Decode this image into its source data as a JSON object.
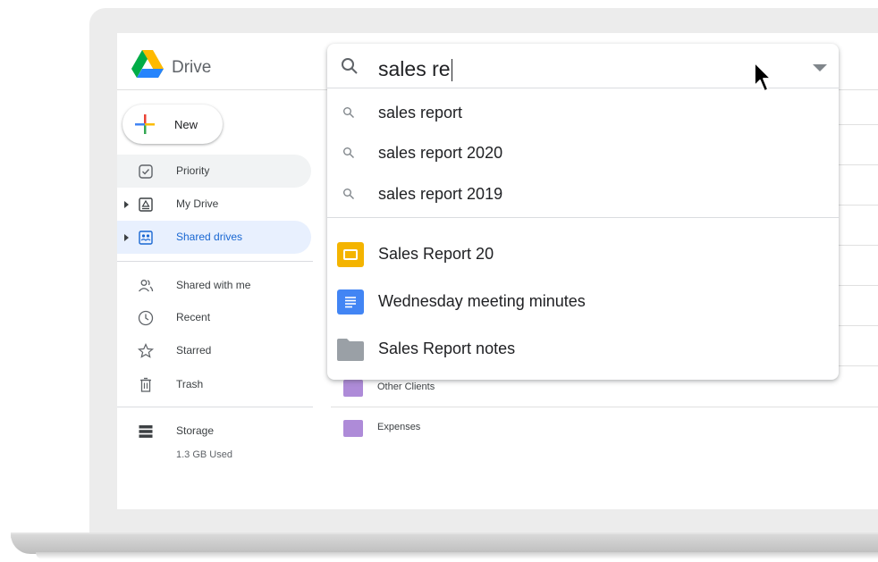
{
  "app": {
    "name": "Drive"
  },
  "new_button": {
    "label": "New"
  },
  "nav": {
    "priority": "Priority",
    "my_drive": "My Drive",
    "shared_drives": "Shared drives",
    "shared_with_me": "Shared with me",
    "recent": "Recent",
    "starred": "Starred",
    "trash": "Trash",
    "storage": "Storage",
    "storage_used": "1.3 GB Used"
  },
  "search": {
    "query": "sales re",
    "suggestions": [
      "sales report",
      "sales report 2020",
      "sales report 2019"
    ],
    "results": [
      {
        "name": "Sales Report 20",
        "type": "slides-icon"
      },
      {
        "name": "Wednesday meeting minutes",
        "type": "docs-icon"
      },
      {
        "name": "Sales Report notes",
        "type": "folder-icon"
      }
    ]
  },
  "files": [
    {
      "name": "Other Clients"
    },
    {
      "name": "Expenses"
    }
  ],
  "colors": {
    "accent": "#1967d2",
    "selected_bg": "#e8f0fe",
    "folder_purple": "#ae8bd8",
    "slides_yellow": "#f4b400",
    "docs_blue": "#4285f4",
    "folder_gray": "#9aa0a6"
  }
}
